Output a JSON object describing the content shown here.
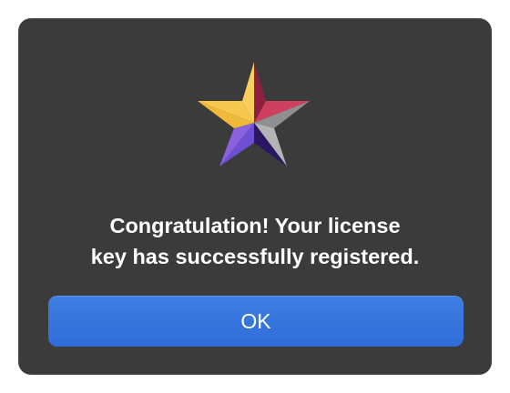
{
  "dialog": {
    "icon": "starred-app-icon",
    "message_line1": "Congratulation! Your license",
    "message_line2": "key has successfully registered.",
    "ok_label": "OK"
  },
  "colors": {
    "dialog_background": "#3b3b3b",
    "button_background": "#3474dd",
    "text": "#ffffff",
    "star_yellow": "#f5c246",
    "star_red": "#c9385b",
    "star_gray": "#9e9e9e",
    "star_purple": "#6f4ed0",
    "star_navy": "#2a1a6e"
  }
}
